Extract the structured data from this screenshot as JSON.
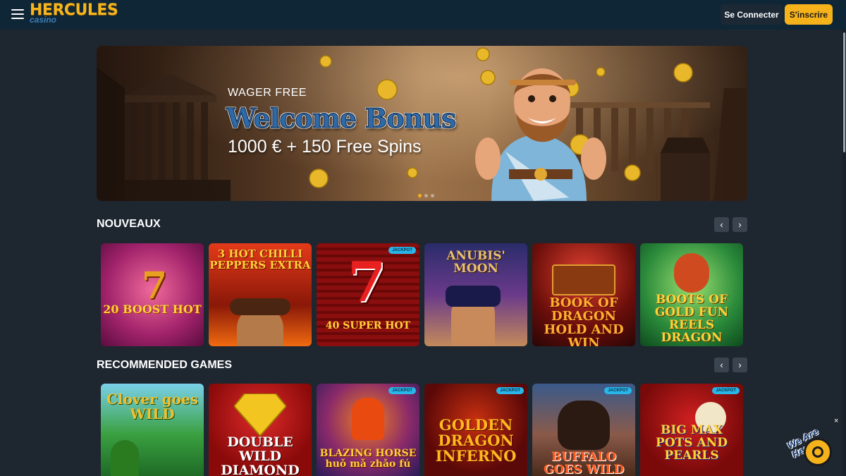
{
  "header": {
    "logo_main": "HERCULES",
    "logo_sub": "casino",
    "login_label": "Se Connecter",
    "register_label": "S'inscrire"
  },
  "banner": {
    "eyebrow": "WAGER FREE",
    "title": "Welcome Bonus",
    "offer": "1000 € + 150 Free Spins",
    "slide_count": 3,
    "active_slide": 1
  },
  "sections": [
    {
      "title": "NOUVEAUX",
      "games": [
        {
          "name": "20 BOOST HOT",
          "jackpot": false
        },
        {
          "name": "3 HOT CHILLI PEPPERS EXTRA",
          "jackpot": false
        },
        {
          "name": "40 SUPER HOT",
          "jackpot": true
        },
        {
          "name": "ANUBIS' MOON",
          "jackpot": false
        },
        {
          "name": "BOOK OF DRAGON HOLD AND WIN",
          "jackpot": false
        },
        {
          "name": "BOOTS OF GOLD FUN REELS DRAGON",
          "jackpot": false
        }
      ]
    },
    {
      "title": "RECOMMENDED GAMES",
      "games": [
        {
          "name": "Clover goes WILD",
          "jackpot": false
        },
        {
          "name": "DOUBLE WILD DIAMOND",
          "jackpot": false
        },
        {
          "name": "BLAZING HORSE huǒ mǎ zhǎo fú",
          "jackpot": true
        },
        {
          "name": "GOLDEN DRAGON INFERNO",
          "jackpot": true
        },
        {
          "name": "BUFFALO GOES WILD",
          "jackpot": true
        },
        {
          "name": "BIG MAX POTS AND PEARLS",
          "jackpot": true
        }
      ]
    }
  ],
  "jackpot_label": "JACKPOT",
  "chat": {
    "label": "We Are Here!",
    "close": "×"
  },
  "colors": {
    "accent": "#f5b21a",
    "header_bg": "#0f2636",
    "page_bg": "#1e2630",
    "jackpot_badge": "#29b6e8"
  }
}
